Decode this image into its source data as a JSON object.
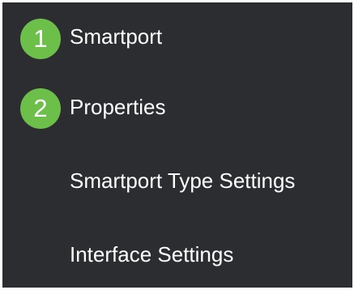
{
  "nav": {
    "items": [
      {
        "step": "1",
        "label": "Smartport"
      },
      {
        "step": "2",
        "label": "Properties"
      },
      {
        "step": "",
        "label": "Smartport Type Settings"
      },
      {
        "step": "",
        "label": "Interface Settings"
      }
    ]
  },
  "colors": {
    "background": "#2b2d31",
    "badge": "#6cc04a",
    "text": "#ffffff"
  }
}
